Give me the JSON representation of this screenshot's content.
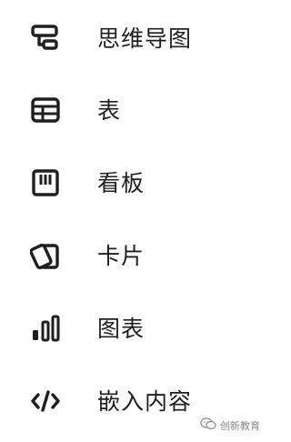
{
  "menu": {
    "items": [
      {
        "label": "思维导图",
        "icon": "mindmap-icon"
      },
      {
        "label": "表",
        "icon": "table-icon"
      },
      {
        "label": "看板",
        "icon": "kanban-icon"
      },
      {
        "label": "卡片",
        "icon": "cards-icon"
      },
      {
        "label": "图表",
        "icon": "chart-icon"
      },
      {
        "label": "嵌入内容",
        "icon": "embed-code-icon"
      }
    ]
  },
  "watermark": {
    "text": "创新教育",
    "icon": "wechat-icon"
  },
  "colors": {
    "icon": "#1f1f1f",
    "text": "#1f1f1f",
    "watermark": "#8a8a8a",
    "background": "#ffffff"
  }
}
